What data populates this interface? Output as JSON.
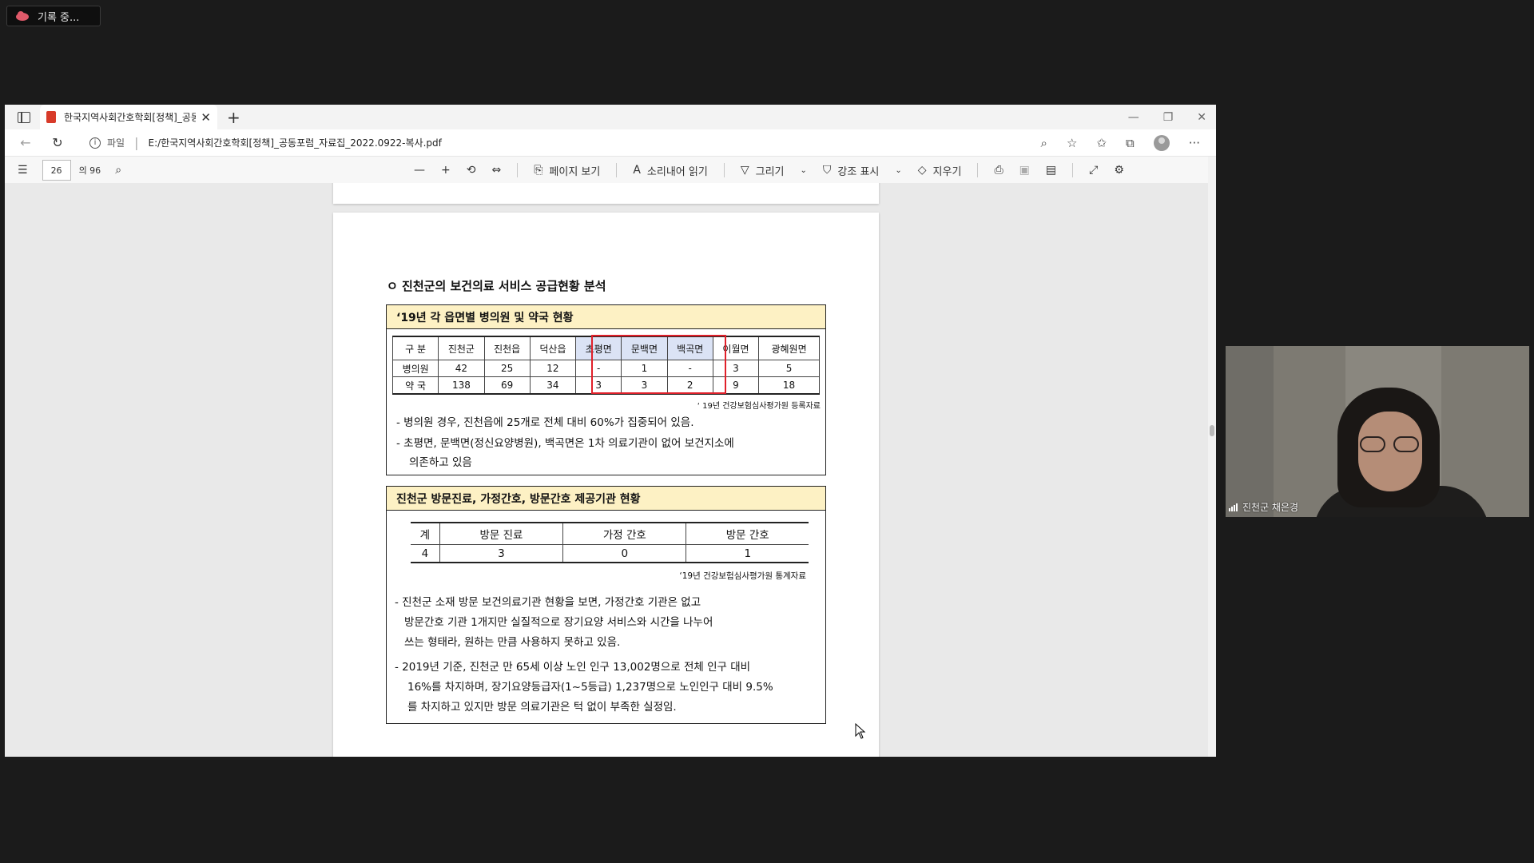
{
  "recording": {
    "label": "기록 중..."
  },
  "browser": {
    "tab_title": "한국지역사회간호학회[정책]_공동",
    "address_prefix": "파일",
    "url": "E:/한국지역사회간호학회[정책]_공동포럼_자료집_2022.0922-복사.pdf"
  },
  "pdf_toolbar": {
    "current_page": "26",
    "total_pages": "의 96",
    "page_view": "페이지 보기",
    "read_aloud": "소리내어 읽기",
    "draw": "그리기",
    "highlight": "강조 표시",
    "erase": "지우기"
  },
  "doc": {
    "section_title": "진천군의 보건의료 서비스 공급현황 분석",
    "table1": {
      "title": "‘19년 각 읍면별 병의원 및 약국 현황",
      "headers": [
        "구 분",
        "진천군",
        "진천읍",
        "덕산읍",
        "초평면",
        "문백면",
        "백곡면",
        "이월면",
        "광혜원면"
      ],
      "rows": [
        [
          "병의원",
          "42",
          "25",
          "12",
          "-",
          "1",
          "-",
          "3",
          "5"
        ],
        [
          "약 국",
          "138",
          "69",
          "34",
          "3",
          "3",
          "2",
          "9",
          "18"
        ]
      ],
      "source": "‘ 19년 건강보험심사평가원 등록자료",
      "bullet1": "- 병의원 경우, 진천읍에 25개로 전체 대비 60%가 집중되어 있음.",
      "bullet2a": "- 초평면, 문백면(정신요양병원), 백곡면은 1차 의료기관이 없어 보건지소에",
      "bullet2b": "의존하고 있음"
    },
    "table2": {
      "title": "진천군 방문진료, 가정간호, 방문간호 제공기관 현황",
      "headers": [
        "계",
        "방문 진료",
        "가정 간호",
        "방문 간호"
      ],
      "row": [
        "4",
        "3",
        "0",
        "1"
      ],
      "source": "‘19년 건강보험심사평가원 통계자료",
      "p1a": "- 진천군 소재 방문 보건의료기관 현황을 보면, 가정간호 기관은 없고",
      "p1b": "방문간호 기관 1개지만 실질적으로 장기요양 서비스와 시간을 나누어",
      "p1c": "쓰는 형태라, 원하는 만큼 사용하지 못하고 있음.",
      "p2a": "- 2019년 기준, 진천군 만 65세 이상 노인 인구 13,002명으로 전체 인구 대비",
      "p2b": "16%를 차지하며, 장기요양등급자(1~5등급) 1,237명으로 노인인구 대비 9.5%",
      "p2c": "를 차지하고 있지만 방문 의료기관은 턱 없이 부족한 실정임."
    }
  },
  "video": {
    "participant": "진천군 채은경"
  },
  "colors": {
    "highlight_red": "#e0202a",
    "table_header_fill": "#fdf1c4",
    "cell_highlight": "#dbe3f5"
  }
}
